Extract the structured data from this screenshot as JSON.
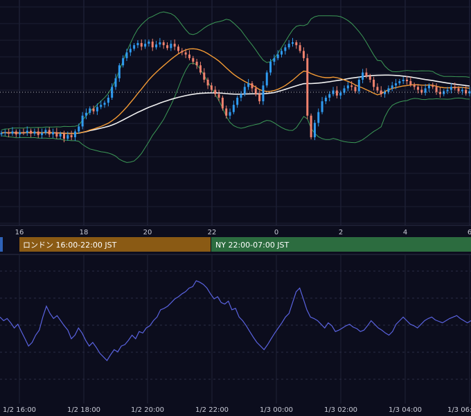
{
  "chart_data": [
    {
      "type": "candlestick",
      "title": "",
      "x_ticks": [
        "16",
        "18",
        "20",
        "22",
        "0",
        "2",
        "4",
        "6"
      ],
      "indicators": [
        "Bollinger Bands",
        "moving average (orange)",
        "moving average (white)"
      ],
      "grid": true,
      "colors": {
        "up": "#2f9bf0",
        "down": "#f0826e",
        "bollinger": "#3c9a57",
        "ma_fast": "#f39a34",
        "ma_slow": "#f2f2f2",
        "price_line": "#ffffff"
      },
      "candles_close_relative": [
        46,
        47,
        45,
        48,
        44,
        47,
        46,
        49,
        45,
        48,
        43,
        46,
        50,
        44,
        47,
        41,
        45,
        38,
        43,
        40,
        48,
        55,
        70,
        74,
        80,
        76,
        82,
        85,
        88,
        95,
        110,
        122,
        140,
        150,
        158,
        163,
        168,
        171,
        166,
        170,
        173,
        165,
        169,
        172,
        168,
        164,
        170,
        166,
        160,
        158,
        155,
        150,
        145,
        140,
        130,
        120,
        112,
        106,
        100,
        95,
        80,
        70,
        75,
        85,
        95,
        100,
        110,
        115,
        108,
        100,
        90,
        112,
        130,
        145,
        150,
        155,
        160,
        165,
        170,
        172,
        168,
        160,
        150,
        70,
        40,
        60,
        75,
        90,
        95,
        100,
        105,
        98,
        102,
        108,
        112,
        110,
        104,
        120,
        130,
        125,
        120,
        110,
        105,
        100,
        103,
        108,
        112,
        115,
        118,
        120,
        118,
        113,
        110,
        106,
        102,
        108,
        112,
        110,
        103,
        100,
        104,
        106,
        110,
        108,
        104,
        106,
        101,
        104
      ]
    },
    {
      "type": "line",
      "title": "",
      "x_ticks": [
        "1/2 16:00",
        "1/2 18:00",
        "1/2 20:00",
        "1/2 22:00",
        "1/3 00:00",
        "1/3 02:00",
        "1/3 04:00",
        "1/3 06:00"
      ],
      "series": [
        {
          "color": "#5a63e0",
          "values_relative": [
            60,
            55,
            58,
            52,
            45,
            50,
            40,
            30,
            20,
            25,
            35,
            42,
            60,
            75,
            65,
            58,
            62,
            55,
            48,
            42,
            30,
            35,
            45,
            38,
            28,
            20,
            25,
            18,
            10,
            5,
            0,
            8,
            15,
            12,
            20,
            22,
            28,
            35,
            30,
            40,
            38,
            45,
            48,
            55,
            60,
            70,
            72,
            75,
            80,
            85,
            88,
            92,
            95,
            100,
            102,
            110,
            108,
            105,
            100,
            92,
            85,
            88,
            80,
            78,
            82,
            70,
            72,
            60,
            55,
            48,
            40,
            32,
            25,
            20,
            15,
            22,
            30,
            38,
            45,
            52,
            60,
            65,
            80,
            95,
            100,
            85,
            70,
            60,
            58,
            55,
            50,
            45,
            52,
            48,
            40,
            42,
            45,
            48,
            50,
            46,
            44,
            40,
            42,
            48,
            55,
            50,
            45,
            42,
            38,
            35,
            40,
            50,
            55,
            60,
            55,
            50,
            48,
            45,
            50,
            55,
            58,
            60,
            56,
            54,
            52,
            55,
            58,
            60,
            62,
            58,
            55,
            52,
            55
          ]
        }
      ]
    }
  ],
  "sessions": [
    {
      "label": "ロンドン 16:00-22:00 JST",
      "color": "#8a5a14"
    },
    {
      "label": "NY 22:00-07:00 JST",
      "color": "#2c6c3f"
    }
  ]
}
